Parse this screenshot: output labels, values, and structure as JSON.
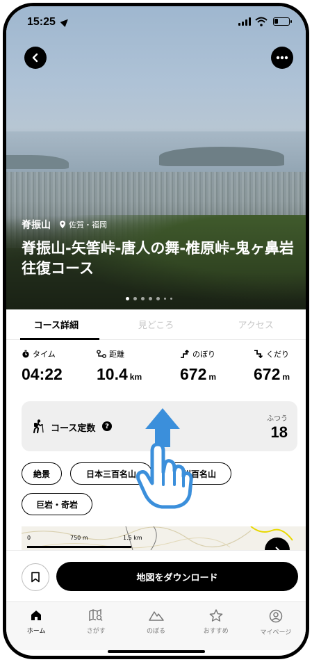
{
  "status_bar": {
    "time": "15:25"
  },
  "hero": {
    "mountain": "脊振山",
    "prefecture": "佐賀・福岡",
    "course_title": "脊振山-矢筈峠-唐人の舞-椎原峠-鬼ヶ鼻岩 往復コース"
  },
  "tabs": [
    {
      "label": "コース詳細",
      "active": true
    },
    {
      "label": "見どころ",
      "active": false
    },
    {
      "label": "アクセス",
      "active": false
    }
  ],
  "stats": {
    "time": {
      "label": "タイム",
      "value": "04:22",
      "unit": ""
    },
    "distance": {
      "label": "距離",
      "value": "10.4",
      "unit": "km"
    },
    "ascent": {
      "label": "のぼり",
      "value": "672",
      "unit": "m"
    },
    "descent": {
      "label": "くだり",
      "value": "672",
      "unit": "m"
    }
  },
  "course_constant": {
    "label": "コース定数",
    "help": "?",
    "difficulty": "ふつう",
    "value": "18"
  },
  "tags": [
    "絶景",
    "日本三百名山",
    "九州百名山",
    "巨岩・奇岩"
  ],
  "map": {
    "scale_0": "0",
    "scale_1": "750 m",
    "scale_2": "1.5 km"
  },
  "actions": {
    "download": "地図をダウンロード"
  },
  "nav": [
    {
      "label": "ホーム",
      "icon": "home-icon",
      "active": true
    },
    {
      "label": "さがす",
      "icon": "map-search-icon",
      "active": false
    },
    {
      "label": "のぼる",
      "icon": "mountain-icon",
      "active": false
    },
    {
      "label": "おすすめ",
      "icon": "star-icon",
      "active": false
    },
    {
      "label": "マイページ",
      "icon": "user-icon",
      "active": false
    }
  ],
  "colors": {
    "primary": "#000000",
    "tag_border": "#000000",
    "card_bg": "#efefef",
    "hand_overlay": "#3b8fdb"
  }
}
